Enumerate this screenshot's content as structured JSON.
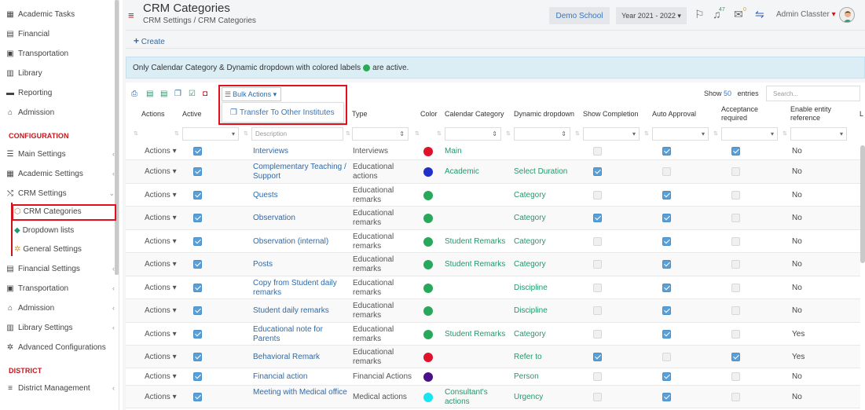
{
  "sidebar": {
    "items": [
      {
        "label": "Academic Tasks",
        "icon": "tasks-icon"
      },
      {
        "label": "Financial",
        "icon": "money-icon"
      },
      {
        "label": "Transportation",
        "icon": "bus-icon"
      },
      {
        "label": "Library",
        "icon": "library-icon"
      },
      {
        "label": "Reporting",
        "icon": "print-icon"
      },
      {
        "label": "Admission",
        "icon": "building-icon"
      }
    ],
    "config_heading": "CONFIGURATION",
    "config_items": [
      {
        "label": "Main Settings",
        "icon": "sliders-icon"
      },
      {
        "label": "Academic Settings",
        "icon": "grid-icon"
      },
      {
        "label": "CRM Settings",
        "icon": "shuffle-icon"
      }
    ],
    "crm_sub": [
      {
        "label": "CRM Categories",
        "icon": "tag-icon"
      },
      {
        "label": "Dropdown lists",
        "icon": "layers-icon"
      },
      {
        "label": "General Settings",
        "icon": "gears-icon"
      }
    ],
    "more_items": [
      {
        "label": "Financial Settings",
        "icon": "money-icon"
      },
      {
        "label": "Transportation",
        "icon": "bus-icon"
      },
      {
        "label": "Admission",
        "icon": "building-icon"
      },
      {
        "label": "Library Settings",
        "icon": "library-icon"
      },
      {
        "label": "Advanced Configurations",
        "icon": "gears-icon"
      }
    ],
    "district_heading": "DISTRICT",
    "district_items": [
      {
        "label": "District Management",
        "icon": "menu-icon"
      }
    ]
  },
  "header": {
    "title": "CRM Categories",
    "breadcrumb": "CRM Settings  /  CRM Categories",
    "school": "Demo School",
    "year": "Year 2021 - 2022",
    "notif_count": "47",
    "msg_count": "0",
    "user": "Admin Classter"
  },
  "create_label": "Create",
  "info_text_before": "Only Calendar Category & Dynamic dropdown with colored labels",
  "info_text_after": "are active.",
  "toolbar": {
    "bulk_label": "Bulk Actions",
    "menu_item": "Transfer To Other Institutes",
    "show_label": "Show",
    "show_value": "50",
    "entries_label": "entries",
    "search_placeholder": "Search..."
  },
  "columns": [
    "Actions",
    "Active",
    "Description",
    "Type",
    "Color",
    "Calendar Category",
    "Dynamic dropdown",
    "Show Completion",
    "Auto Approval",
    "Acceptance required",
    "Enable entity reference",
    "L"
  ],
  "filters": {
    "description_placeholder": "Description"
  },
  "colors": {
    "red": "#e0112b",
    "blue": "#1f2fc8",
    "green": "#28a85a",
    "purple": "#4b0f8a",
    "cyan": "#17e5f0"
  },
  "rows": [
    {
      "desc": "Interviews",
      "type": "Interviews",
      "color": "red",
      "cal": "Main",
      "dyn": "",
      "show": false,
      "auto": true,
      "accept": true,
      "entity": "No"
    },
    {
      "desc": "Complementary Teaching / Support",
      "type": "Educational actions",
      "color": "blue",
      "cal": "Academic",
      "dyn": "Select Duration",
      "show": true,
      "auto": false,
      "accept": false,
      "entity": "No"
    },
    {
      "desc": "Quests",
      "type": "Educational remarks",
      "color": "green",
      "cal": "",
      "dyn": "Category",
      "show": false,
      "auto": true,
      "accept": false,
      "entity": "No"
    },
    {
      "desc": "Observation",
      "type": "Educational remarks",
      "color": "green",
      "cal": "",
      "dyn": "Category",
      "show": true,
      "auto": true,
      "accept": false,
      "entity": "No"
    },
    {
      "desc": "Observation (internal)",
      "type": "Educational remarks",
      "color": "green",
      "cal": "Student Remarks",
      "dyn": "Category",
      "show": false,
      "auto": true,
      "accept": false,
      "entity": "No"
    },
    {
      "desc": "Posts",
      "type": "Educational remarks",
      "color": "green",
      "cal": "Student Remarks",
      "dyn": "Category",
      "show": false,
      "auto": true,
      "accept": false,
      "entity": "No"
    },
    {
      "desc": "Copy from Student daily remarks",
      "type": "Educational remarks",
      "color": "green",
      "cal": "",
      "dyn": "Discipline",
      "show": false,
      "auto": true,
      "accept": false,
      "entity": "No"
    },
    {
      "desc": "Student daily remarks",
      "type": "Educational remarks",
      "color": "green",
      "cal": "",
      "dyn": "Discipline",
      "show": false,
      "auto": true,
      "accept": false,
      "entity": "No"
    },
    {
      "desc": "Educational note for Parents",
      "type": "Educational remarks",
      "color": "green",
      "cal": "Student Remarks",
      "dyn": "Category",
      "show": false,
      "auto": true,
      "accept": false,
      "entity": "Yes"
    },
    {
      "desc": "Behavioral Remark",
      "type": "Educational remarks",
      "color": "red",
      "cal": "",
      "dyn": "Refer to",
      "show": true,
      "auto": false,
      "accept": true,
      "entity": "Yes"
    },
    {
      "desc": "Financial action",
      "type": "Financial Actions",
      "color": "purple",
      "cal": "",
      "dyn": "Person",
      "show": false,
      "auto": true,
      "accept": false,
      "entity": "No"
    },
    {
      "desc": "Meeting with Medical office",
      "type": "Medical actions",
      "color": "cyan",
      "cal": "Consultant's actions",
      "dyn": "Urgency",
      "show": false,
      "auto": true,
      "accept": false,
      "entity": "No"
    }
  ],
  "row_action_label": "Actions"
}
